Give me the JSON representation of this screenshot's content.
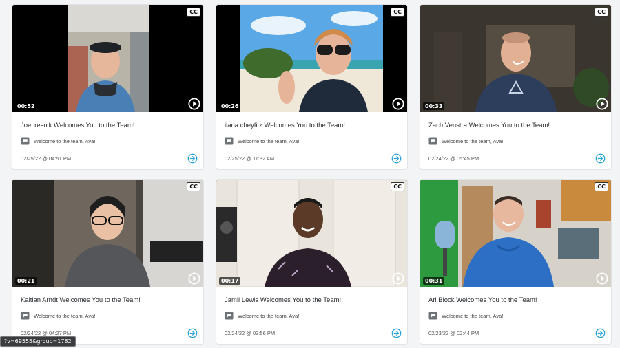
{
  "cards": [
    {
      "title": "Joel resnik Welcomes You to the Team!",
      "message": "Welcome to the team, Ava!",
      "date": "02/25/22 @ 04:51 PM",
      "duration": "00:52",
      "cc": "CC"
    },
    {
      "title": "ilana cheyfitz Welcomes You to the Team!",
      "message": "Welcome to the team, Ava!",
      "date": "02/25/22 @ 11:32 AM",
      "duration": "00:26",
      "cc": "CC"
    },
    {
      "title": "Zach Venstra Welcomes You to the Team!",
      "message": "Welcome to the team, Ava!",
      "date": "02/24/22 @ 05:45 PM",
      "duration": "00:33",
      "cc": "CC"
    },
    {
      "title": "Kaitlan Arndt Welcomes You to the Team!",
      "message": "Welcome to the team, Ava!",
      "date": "02/24/22 @ 04:27 PM",
      "duration": "00:21",
      "cc": "CC"
    },
    {
      "title": "Jamii Lewis Welcomes You to the Team!",
      "message": "Welcome to the team, Ava!",
      "date": "02/24/22 @ 03:56 PM",
      "duration": "00:17",
      "cc": "CC"
    },
    {
      "title": "Ari Block Welcomes You to the Team!",
      "message": "Welcome to the team, Ava!",
      "date": "02/23/22 @ 02:44 PM",
      "duration": "00:31",
      "cc": "CC"
    }
  ],
  "status_url": "?v=69555&group=1782",
  "colors": {
    "accent": "#2fa4d9",
    "card_border": "#e1e3e6",
    "background": "#f3f4f5"
  },
  "icons": {
    "chat": "chat-bubble-icon",
    "go": "arrow-circle-right-icon",
    "play": "play-circle-icon"
  }
}
